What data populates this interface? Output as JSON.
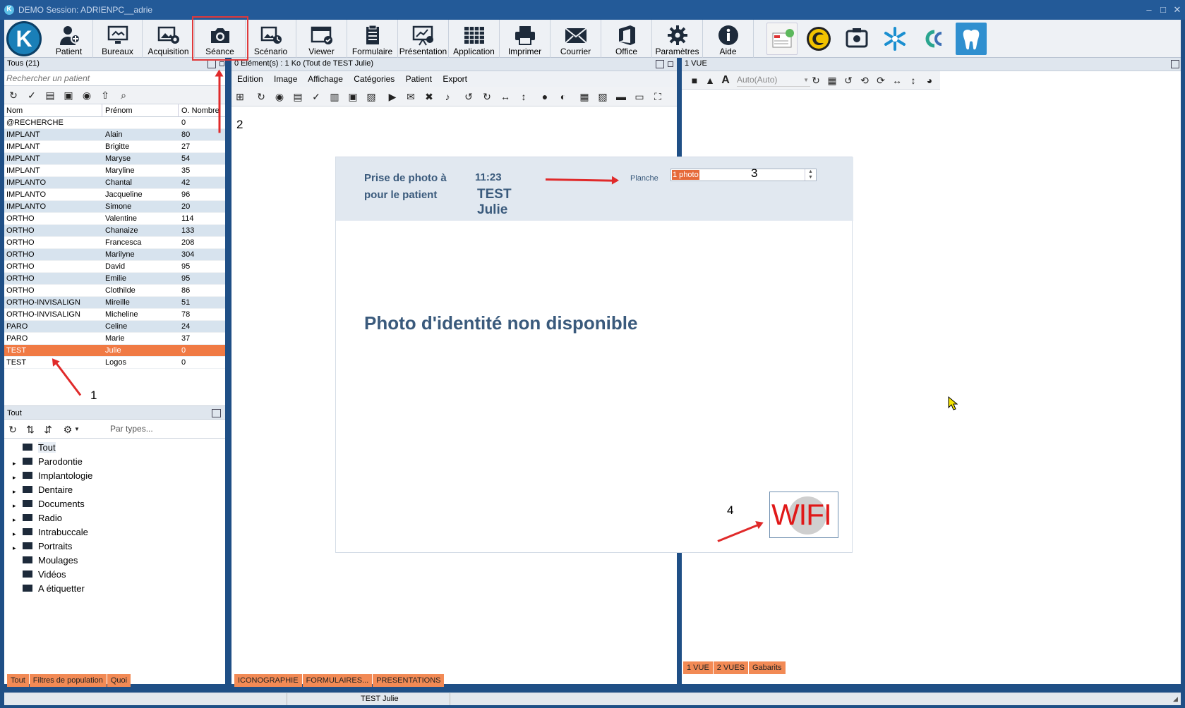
{
  "window": {
    "title": "DEMO Session: ADRIENPC__adrie"
  },
  "toolbar": {
    "items": [
      {
        "label": "Patient",
        "icon": "patient-add-icon"
      },
      {
        "label": "Bureaux",
        "icon": "desktop-icon"
      },
      {
        "label": "Acquisition",
        "icon": "image-acquisition-icon"
      },
      {
        "label": "Séance",
        "icon": "camera-icon"
      },
      {
        "label": "Scénario",
        "icon": "scenario-icon"
      },
      {
        "label": "Viewer",
        "icon": "viewer-icon"
      },
      {
        "label": "Formulaire",
        "icon": "form-icon"
      },
      {
        "label": "Présentation",
        "icon": "presentation-icon"
      },
      {
        "label": "Application",
        "icon": "application-grid-icon"
      },
      {
        "label": "Imprimer",
        "icon": "printer-icon"
      },
      {
        "label": "Courrier",
        "icon": "mail-icon"
      },
      {
        "label": "Office",
        "icon": "office-icon"
      },
      {
        "label": "Paramètres",
        "icon": "gear-icon"
      },
      {
        "label": "Aide",
        "icon": "info-icon"
      }
    ],
    "highlight_color": "#e0393a"
  },
  "left_panel": {
    "header": "Tous (21)",
    "search_placeholder": "Rechercher un patient",
    "columns": [
      "Nom",
      "Prénom",
      "O. Nombre"
    ],
    "rows": [
      [
        "@RECHERCHE",
        "",
        "0"
      ],
      [
        "IMPLANT",
        "Alain",
        "80"
      ],
      [
        "IMPLANT",
        "Brigitte",
        "27"
      ],
      [
        "IMPLANT",
        "Maryse",
        "54"
      ],
      [
        "IMPLANT",
        "Maryline",
        "35"
      ],
      [
        "IMPLANTO",
        "Chantal",
        "42"
      ],
      [
        "IMPLANTO",
        "Jacqueline",
        "96"
      ],
      [
        "IMPLANTO",
        "Simone",
        "20"
      ],
      [
        "ORTHO",
        "Valentine",
        "114"
      ],
      [
        "ORTHO",
        "Chanaize",
        "133"
      ],
      [
        "ORTHO",
        "Francesca",
        "208"
      ],
      [
        "ORTHO",
        "Marilyne",
        "304"
      ],
      [
        "ORTHO",
        "David",
        "95"
      ],
      [
        "ORTHO",
        "Emilie",
        "95"
      ],
      [
        "ORTHO",
        "Clothilde",
        "86"
      ],
      [
        "ORTHO-INVISALIGN",
        "Mireille",
        "51"
      ],
      [
        "ORTHO-INVISALIGN",
        "Micheline",
        "78"
      ],
      [
        "PARO",
        "Celine",
        "24"
      ],
      [
        "PARO",
        "Marie",
        "37"
      ],
      [
        "TEST",
        "Julie",
        "0"
      ],
      [
        "TEST",
        "Logos",
        "0"
      ]
    ],
    "selected_index": 19
  },
  "category_panel": {
    "header": "Tout",
    "filter_placeholder": "Par types...",
    "items": [
      "Tout",
      "Parodontie",
      "Implantologie",
      "Dentaire",
      "Documents",
      "Radio",
      "Intrabuccale",
      "Portraits",
      "Moulages",
      "Vidéos",
      "A étiquetter"
    ],
    "expandable": [
      false,
      true,
      true,
      true,
      true,
      true,
      true,
      true,
      false,
      false,
      false
    ],
    "tabs": [
      "Tout",
      "Filtres de population",
      "Quoi"
    ]
  },
  "center_panel": {
    "header": "0 Elément(s) : 1 Ko (Tout de TEST Julie)",
    "menu": [
      "Edition",
      "Image",
      "Affichage",
      "Catégories",
      "Patient",
      "Export"
    ],
    "tabs": [
      "ICONOGRAPHIE",
      "FORMULAIRES...",
      "PRESENTATIONS"
    ]
  },
  "session_card": {
    "title_line1": "Prise de photo à",
    "title_line2": "pour le patient",
    "time": "11:23",
    "patient_last": "TEST",
    "patient_first": "Julie",
    "planche_label": "Planche",
    "planche_value": "1 photo",
    "message": "Photo d'identité non disponible",
    "wifi_text": "WIFI"
  },
  "right_panel": {
    "header": "1 VUE",
    "font_select": "Auto(Auto)",
    "tabs": [
      "1 VUE",
      "2 VUES",
      "Gabarits"
    ]
  },
  "status_bar": {
    "patient": "TEST Julie"
  },
  "annotations": [
    "1",
    "2",
    "3",
    "4"
  ]
}
